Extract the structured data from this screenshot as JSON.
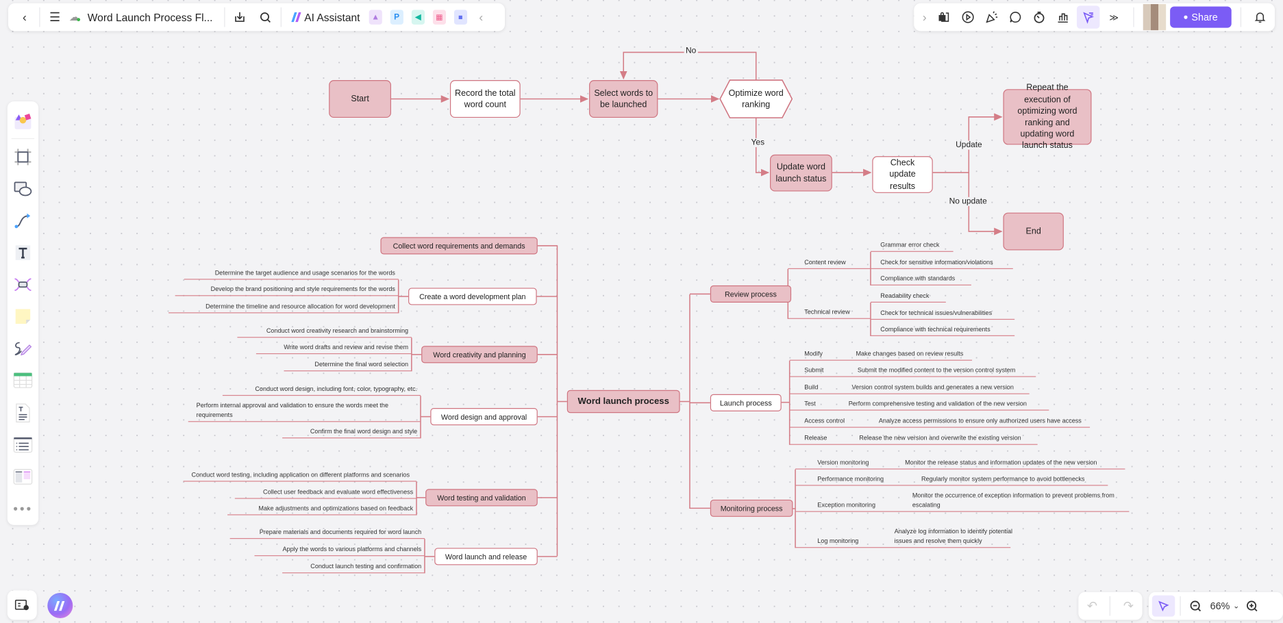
{
  "topbar": {
    "title": "Word Launch Process Fl...",
    "ai_assistant_label": "AI Assistant",
    "share_label": "Share",
    "icons": [
      "back-icon",
      "menu-icon",
      "cloud-saved-icon",
      "download-icon",
      "search-icon",
      "ai-image-icon",
      "ppt-icon",
      "mindmap-icon",
      "flowchart-icon",
      "chat-icon",
      "collapse-icon"
    ],
    "right_icons": [
      "expand-icon",
      "lock-page-icon",
      "play-icon",
      "celebrate-icon",
      "comment-icon",
      "timer-icon",
      "chart-icon",
      "laser-pointer-icon",
      "more-icon",
      "bell-icon"
    ]
  },
  "colors": {
    "accent": "#7b5cf5",
    "node_pink": "#e9c0c6",
    "node_border": "#cf7480",
    "line": "#d47d87"
  },
  "left_toolbar": [
    "templates-icon",
    "frame-icon",
    "shapes-icon",
    "connector-icon",
    "text-icon",
    "mindmap-insert-icon",
    "sticky-note-icon",
    "pen-icon",
    "table-icon",
    "document-icon",
    "list-icon",
    "layout-icon",
    "more-icon"
  ],
  "zoom": {
    "level": "66%"
  },
  "flowchart": {
    "nodes": {
      "start": "Start",
      "record": "Record the total word count",
      "select": "Select words to be launched",
      "optimize": "Optimize word ranking",
      "update": "Update word launch status",
      "check": "Check update results",
      "repeat": "Repeat the execution of optimizing word ranking and updating word launch status",
      "end": "End"
    },
    "labels": {
      "no": "No",
      "yes": "Yes",
      "update": "Update",
      "no_update": "No update"
    }
  },
  "mindmap": {
    "center": "Word launch process",
    "left": [
      {
        "label": "Collect word requirements and demands",
        "children": []
      },
      {
        "label": "Create a word development plan",
        "children": [
          "Determine the target audience and usage scenarios for the words",
          "Develop the brand positioning and style requirements for the words",
          "Determine the timeline and resource allocation for word development"
        ]
      },
      {
        "label": "Word creativity and planning",
        "children": [
          "Conduct word creativity research and brainstorming",
          "Write word drafts and review and revise them",
          "Determine the final word selection"
        ]
      },
      {
        "label": "Word design and approval",
        "children": [
          "Conduct word design, including font, color, typography, etc.",
          "Perform internal approval and validation to ensure the words meet the requirements",
          "Confirm the final word design and style"
        ]
      },
      {
        "label": "Word testing and validation",
        "children": [
          "Conduct word testing, including application on different platforms and scenarios",
          "Collect user feedback and evaluate word effectiveness",
          "Make adjustments and optimizations based on feedback"
        ]
      },
      {
        "label": "Word launch and release",
        "children": [
          "Prepare materials and documents required for word launch",
          "Apply the words to various platforms and channels",
          "Conduct launch testing and confirmation"
        ]
      }
    ],
    "right": [
      {
        "label": "Review process",
        "children": [
          {
            "label": "Content review",
            "children": [
              "Grammar error check",
              "Check for sensitive information/violations",
              "Compliance with standards"
            ]
          },
          {
            "label": "Technical review",
            "children": [
              "Readability check",
              "Check for technical issues/vulnerabilities",
              "Compliance with technical requirements"
            ]
          }
        ]
      },
      {
        "label": "Launch process",
        "children": [
          {
            "label": "Modify",
            "detail": "Make changes based on review results"
          },
          {
            "label": "Submit",
            "detail": "Submit the modified content to the version control system"
          },
          {
            "label": "Build",
            "detail": "Version control system builds and generates a new version"
          },
          {
            "label": "Test",
            "detail": "Perform comprehensive testing and validation of the new version"
          },
          {
            "label": "Access control",
            "detail": "Analyze access permissions to ensure only authorized users have access"
          },
          {
            "label": "Release",
            "detail": "Release the new version and overwrite the existing version"
          }
        ]
      },
      {
        "label": "Monitoring process",
        "children": [
          {
            "label": "Version monitoring",
            "detail": "Monitor the release status and information updates of the new version"
          },
          {
            "label": "Performance monitoring",
            "detail": "Regularly monitor system performance to avoid bottlenecks"
          },
          {
            "label": "Exception monitoring",
            "detail": "Monitor the occurrence of exception information to prevent problems from escalating"
          },
          {
            "label": "Log monitoring",
            "detail": "Analyze log information to identify potential issues and resolve them quickly"
          }
        ]
      }
    ]
  }
}
